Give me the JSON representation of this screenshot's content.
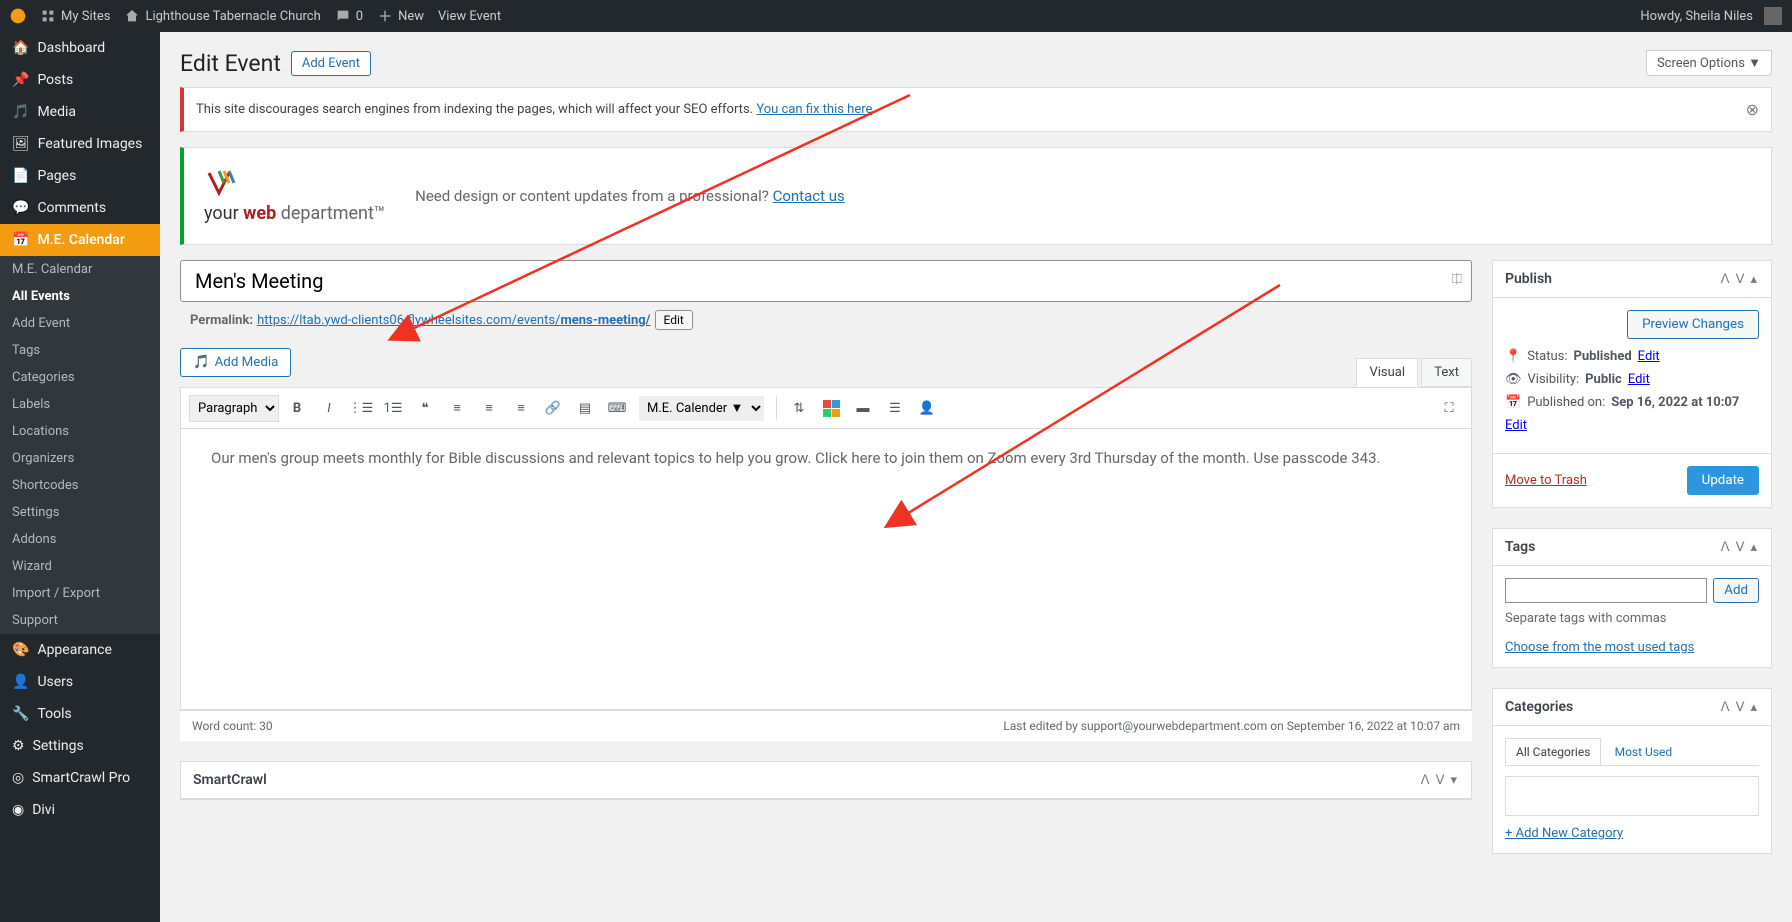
{
  "topbar": {
    "mysites": "My Sites",
    "sitename": "Lighthouse Tabernacle Church",
    "comments": "0",
    "new": "New",
    "view": "View Event",
    "howdy": "Howdy, Sheila Niles"
  },
  "sidebar": {
    "dashboard": "Dashboard",
    "posts": "Posts",
    "media": "Media",
    "featured": "Featured Images",
    "pages": "Pages",
    "comments": "Comments",
    "mec": "M.E. Calendar",
    "appearance": "Appearance",
    "users": "Users",
    "tools": "Tools",
    "settings": "Settings",
    "smartcrawl": "SmartCrawl Pro",
    "divi": "Divi",
    "sub": {
      "mec_cal": "M.E. Calendar",
      "all_events": "All Events",
      "add_event": "Add Event",
      "tags": "Tags",
      "categories": "Categories",
      "labels": "Labels",
      "locations": "Locations",
      "organizers": "Organizers",
      "shortcodes": "Shortcodes",
      "settings_sub": "Settings",
      "addons": "Addons",
      "wizard": "Wizard",
      "import_export": "Import / Export",
      "support": "Support"
    }
  },
  "header": {
    "title": "Edit Event",
    "add_event": "Add Event",
    "screen_options": "Screen Options ▼"
  },
  "notice1": {
    "text": "This site discourages search engines from indexing the pages, which will affect your SEO efforts.",
    "link": "You can fix this here"
  },
  "notice2": {
    "brand_your": "your ",
    "brand_web": "web ",
    "brand_dept": "department™",
    "text": "Need design or content updates from a professional? ",
    "link": "Contact us"
  },
  "event": {
    "title": "Men's Meeting",
    "permalink_label": "Permalink:",
    "permalink_base": "https://ltab.ywd-clients06.flywheelsites.com/events/",
    "permalink_slug": "mens-meeting/",
    "edit_btn": "Edit",
    "body": "Our men's group meets monthly for Bible discussions and relevant topics to help you grow. Click here to join them on Zoom every 3rd Thursday of the month. Use passcode 343."
  },
  "editor": {
    "add_media": "Add Media",
    "visual": "Visual",
    "text": "Text",
    "para": "Paragraph",
    "mec_dropdown": "M.E. Calender ▼",
    "word_count": "Word count: 30",
    "last_edited": "Last edited by support@yourwebdepartment.com on September 16, 2022 at 10:07 am"
  },
  "publish": {
    "title": "Publish",
    "preview": "Preview Changes",
    "status_label": "Status: ",
    "status_value": "Published",
    "status_edit": "Edit",
    "visibility_label": "Visibility: ",
    "visibility_value": "Public",
    "visibility_edit": "Edit",
    "published_label": "Published on: ",
    "published_value": "Sep 16, 2022 at 10:07",
    "published_edit": "Edit",
    "trash": "Move to Trash",
    "update": "Update"
  },
  "tags": {
    "title": "Tags",
    "add": "Add",
    "separate": "Separate tags with commas",
    "choose": "Choose from the most used tags"
  },
  "categories": {
    "title": "Categories",
    "all": "All Categories",
    "most": "Most Used",
    "addnew": "+ Add New Category"
  },
  "smartcrawl": {
    "title": "SmartCrawl"
  }
}
